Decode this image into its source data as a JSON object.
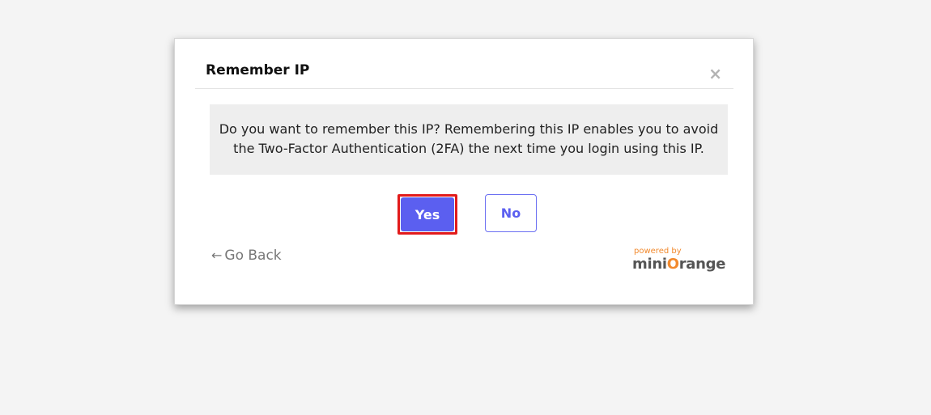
{
  "dialog": {
    "title": "Remember IP",
    "close_symbol": "×",
    "message": "Do you want to remember this IP? Remembering this IP enables you to avoid the Two-Factor Authentication (2FA) the next time you login using this IP.",
    "yes_label": "Yes",
    "no_label": "No",
    "go_back_arrow": "←",
    "go_back_label": "Go Back",
    "powered_by": "powered by",
    "brand_prefix": "mini",
    "brand_o": "O",
    "brand_suffix": "range"
  },
  "colors": {
    "accent": "#5b5ff0",
    "highlight": "#e21b1b",
    "brand_orange": "#f28a2e"
  }
}
